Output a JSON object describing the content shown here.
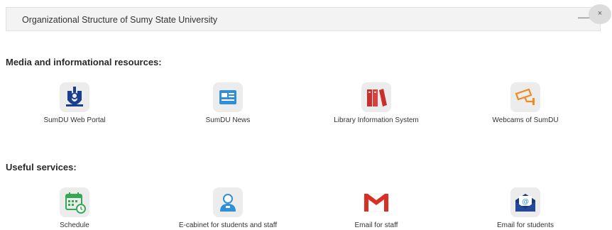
{
  "header": {
    "title": "Organizational Structure of Sumy State University",
    "arrow_glyph": "⟶",
    "close_glyph": "×"
  },
  "sections": {
    "media": {
      "title": "Media and informational resources:",
      "items": [
        {
          "label": "SumDU Web Portal",
          "icon": "sumdu-logo-icon"
        },
        {
          "label": "SumDU News",
          "icon": "newspaper-icon"
        },
        {
          "label": "Library Information System",
          "icon": "books-icon"
        },
        {
          "label": "Webcams of SumDU",
          "icon": "security-camera-icon"
        }
      ]
    },
    "services": {
      "title": "Useful services:",
      "items": [
        {
          "label": "Schedule",
          "icon": "calendar-clock-icon"
        },
        {
          "label": "E-cabinet for students and staff",
          "icon": "user-icon"
        },
        {
          "label": "Email for staff",
          "icon": "gmail-icon"
        },
        {
          "label": "Email for students",
          "icon": "envelope-at-icon"
        }
      ]
    }
  },
  "colors": {
    "sumdu_blue": "#1b3f8f",
    "news_blue": "#2f8fd8",
    "library_red": "#c9302c",
    "camera_orange": "#f08a24",
    "schedule_green": "#35a853",
    "gmail_red": "#d93025",
    "envelope_navy": "#1a3a7a"
  }
}
